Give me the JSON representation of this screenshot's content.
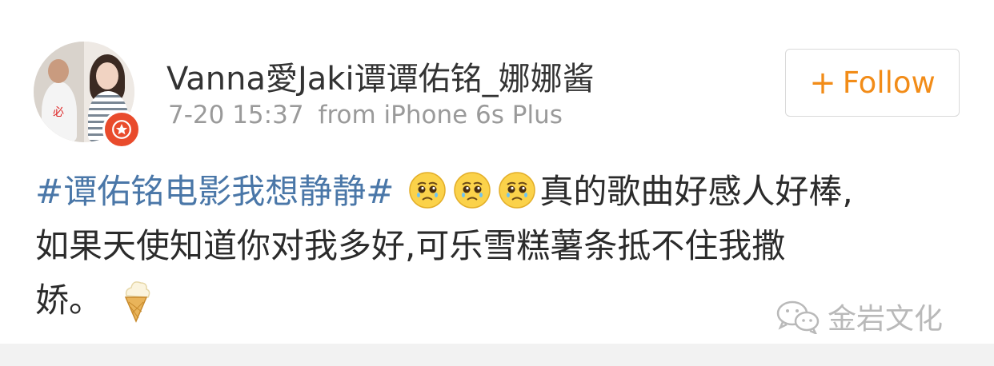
{
  "user": {
    "name": "Vanna愛Jaki谭谭佑铭_娜娜酱",
    "avatar_icon": "couple-photo-avatar",
    "badge_icon": "verified-star-badge-icon"
  },
  "meta": {
    "time": "7-20 15:37",
    "source": "from iPhone 6s Plus"
  },
  "follow_button": {
    "plus": "+",
    "label": "Follow"
  },
  "post": {
    "topic": "#谭佑铭电影我想静静#",
    "emoji": [
      "teary-face-emoji",
      "teary-face-emoji",
      "teary-face-emoji"
    ],
    "text_line1_rest": "真的歌曲好感人好棒,",
    "text_line2": "如果天使知道你对我多好,可乐雪糕薯条抵不住我撒",
    "text_line3": "娇。",
    "trailing_emoji": "ice-cream-cone-emoji"
  },
  "watermark": {
    "icon": "wechat-logo-icon",
    "text": "金岩文化"
  },
  "colors": {
    "accent_orange": "#f28c18",
    "topic_blue": "#4a77a8",
    "badge_red": "#e94b2c",
    "meta_gray": "#9a9a9a"
  }
}
